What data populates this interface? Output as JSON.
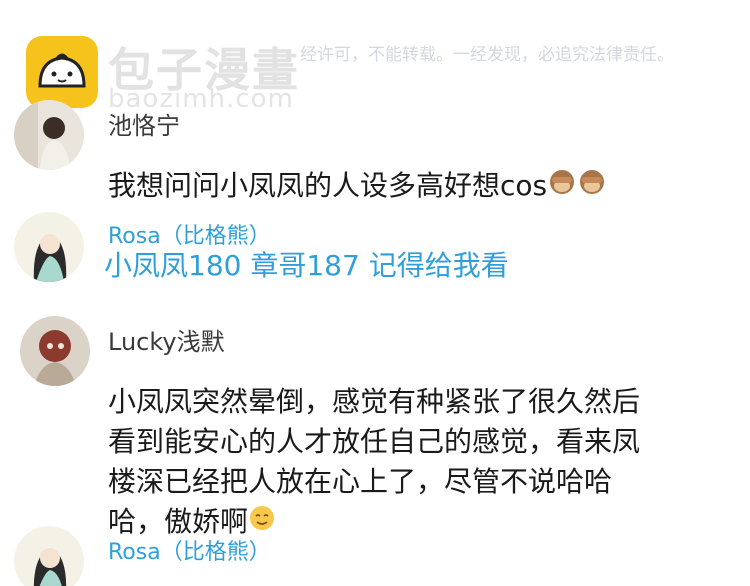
{
  "watermark": {
    "brand": "包子漫畫",
    "url": "baozimh.com",
    "notice": "经许可，不能转载。一经发现，必追究法律责任。"
  },
  "comments": [
    {
      "username": "池恪宁",
      "text": "我想问问小凤凤的人设多高好想cos",
      "emoji": "see-no-evil-monkey-icon"
    },
    {
      "username": "Rosa（比格熊）",
      "text": "小凤凤180 章哥187 记得给我看"
    },
    {
      "username": "Lucky浅默",
      "lines": [
        "小凤凤突然晕倒，感觉有种紧张了很久然后",
        "看到能安心的人才放任自己的感觉，看来凤",
        "楼深已经把人放在心上了，尽管不说哈哈",
        "哈，傲娇啊"
      ],
      "emoji": "relieved-face-icon"
    },
    {
      "username": "Rosa（比格熊）"
    }
  ],
  "colors": {
    "reply_blue": "#2f9fdc",
    "logo_yellow": "#f6c21c",
    "text_dark": "#1a1a1a"
  }
}
